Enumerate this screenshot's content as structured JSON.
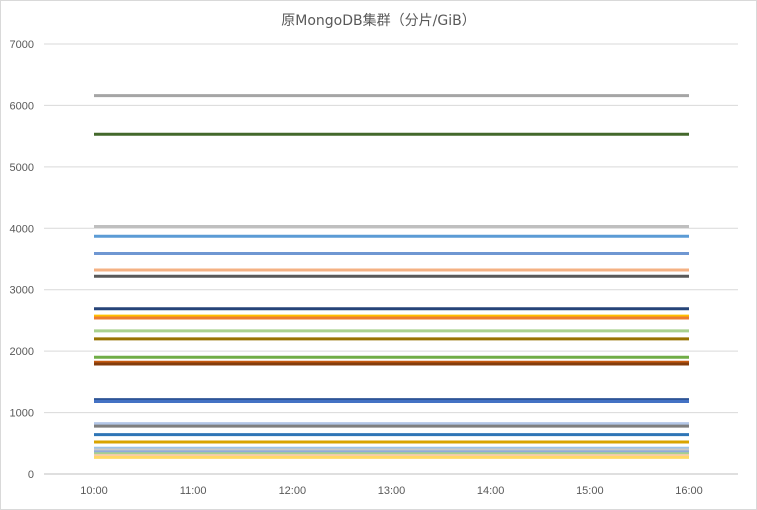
{
  "chart_data": {
    "type": "line",
    "title": "原MongoDB集群（分片/GiB）",
    "categories": [
      "10:00",
      "11:00",
      "12:00",
      "13:00",
      "14:00",
      "15:00",
      "16:00"
    ],
    "ylim": [
      0,
      7000
    ],
    "yticks": [
      0,
      1000,
      2000,
      3000,
      4000,
      5000,
      6000,
      7000
    ],
    "grid": true,
    "legend": "none",
    "series": [
      {
        "value": 6160,
        "color": "#a5a5a5"
      },
      {
        "value": 5530,
        "color": "#43682b"
      },
      {
        "value": 4030,
        "color": "#bfbfbf"
      },
      {
        "value": 3870,
        "color": "#5b9bd5"
      },
      {
        "value": 3590,
        "color": "#6f97d2"
      },
      {
        "value": 3320,
        "color": "#f4b183"
      },
      {
        "value": 3220,
        "color": "#595959"
      },
      {
        "value": 2690,
        "color": "#264478"
      },
      {
        "value": 2570,
        "color": "#ffc000"
      },
      {
        "value": 2540,
        "color": "#ed7d31"
      },
      {
        "value": 2330,
        "color": "#a9d18e"
      },
      {
        "value": 2200,
        "color": "#997300"
      },
      {
        "value": 1900,
        "color": "#70ad47"
      },
      {
        "value": 1820,
        "color": "#c55a11"
      },
      {
        "value": 1790,
        "color": "#843c0c"
      },
      {
        "value": 1210,
        "color": "#2e5597"
      },
      {
        "value": 1180,
        "color": "#4472c4"
      },
      {
        "value": 820,
        "color": "#b4c7e7"
      },
      {
        "value": 780,
        "color": "#7f7f7f"
      },
      {
        "value": 640,
        "color": "#2e75b6"
      },
      {
        "value": 520,
        "color": "#d9a400"
      },
      {
        "value": 420,
        "color": "#9dc3e6"
      },
      {
        "value": 390,
        "color": "#c9c9c9"
      },
      {
        "value": 360,
        "color": "#8faadc"
      },
      {
        "value": 330,
        "color": "#a9d08e"
      },
      {
        "value": 300,
        "color": "#f8cbad"
      },
      {
        "value": 270,
        "color": "#ffd966"
      }
    ]
  }
}
